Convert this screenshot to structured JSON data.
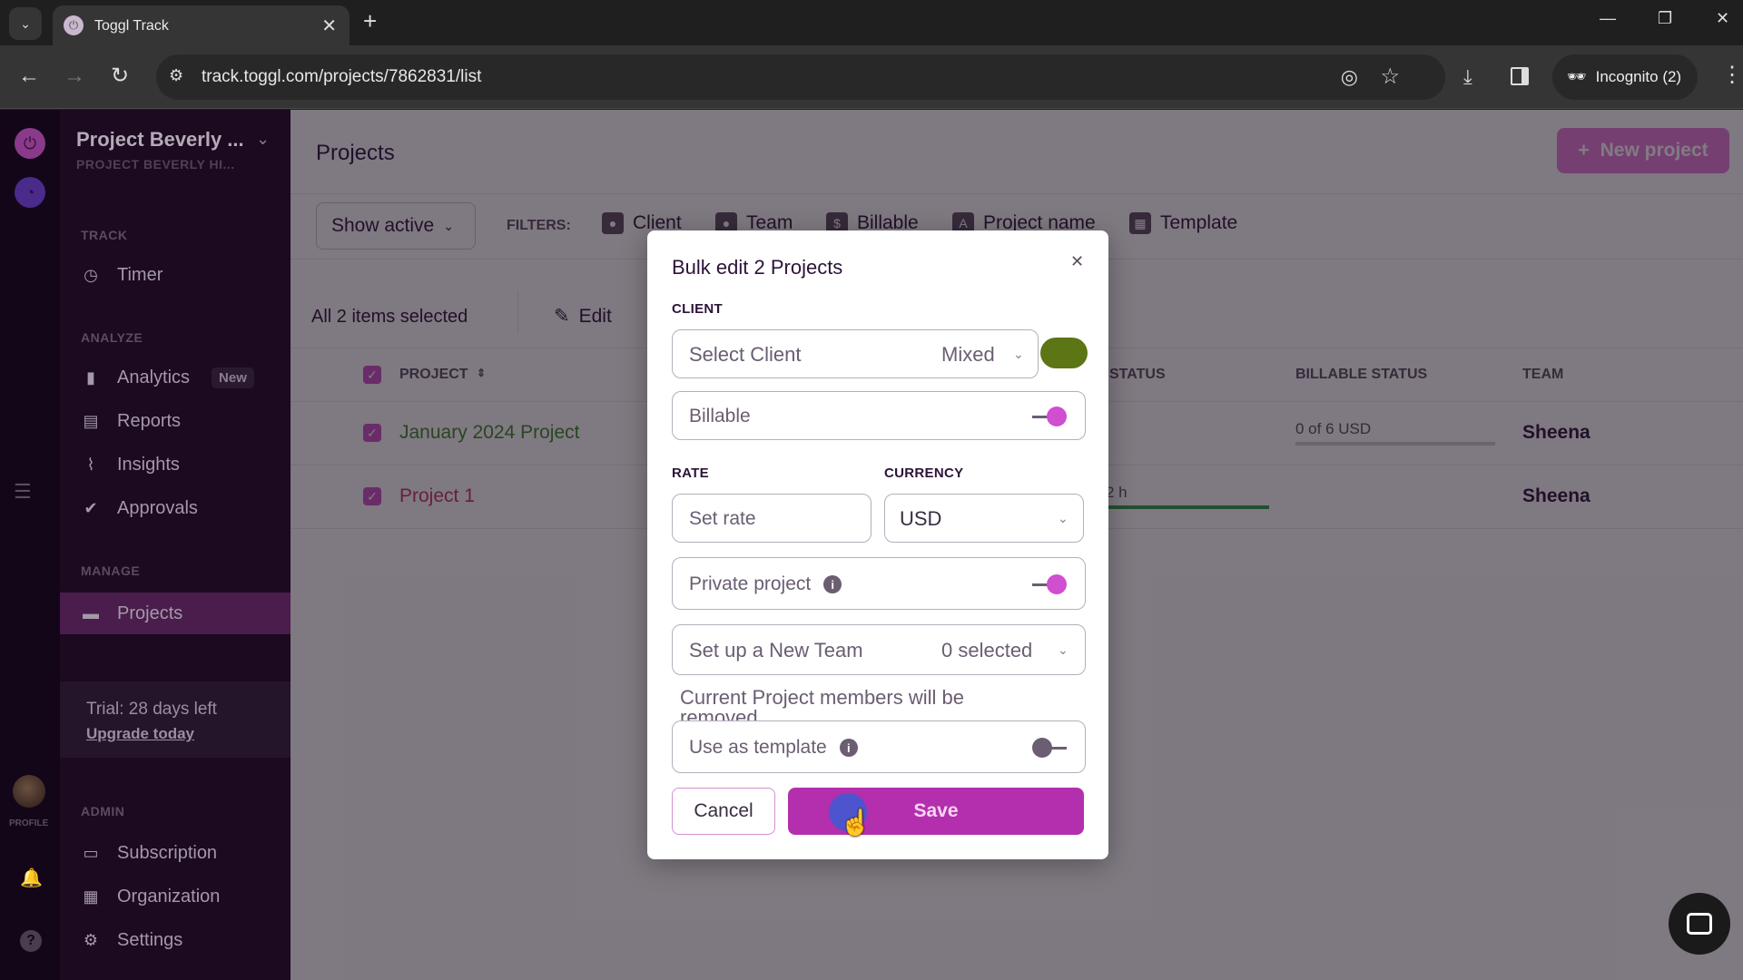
{
  "browser": {
    "tab_title": "Toggl Track",
    "url": "track.toggl.com/projects/7862831/list",
    "incognito_label": "Incognito (2)"
  },
  "sidebar": {
    "workspace_name": "Project Beverly ...",
    "workspace_sub": "PROJECT BEVERLY HI...",
    "sections": {
      "track": "TRACK",
      "analyze": "ANALYZE",
      "manage": "MANAGE",
      "admin": "ADMIN"
    },
    "items": {
      "timer": "Timer",
      "analytics": "Analytics",
      "analytics_badge": "New",
      "reports": "Reports",
      "insights": "Insights",
      "approvals": "Approvals",
      "projects": "Projects",
      "subscription": "Subscription",
      "organization": "Organization",
      "settings": "Settings"
    },
    "trial_text": "Trial: 28 days left",
    "upgrade_label": "Upgrade today",
    "profile_label": "PROFILE"
  },
  "main": {
    "title": "Projects",
    "new_project_label": "New project",
    "show_active_label": "Show active",
    "filters_label": "FILTERS:",
    "filters": [
      "Client",
      "Team",
      "Billable",
      "Project name",
      "Template"
    ],
    "selection_text": "All 2 items selected",
    "edit_label": "Edit",
    "columns": {
      "project": "PROJECT",
      "status": "STATUS",
      "billable_status": "BILLABLE STATUS",
      "team": "TEAM"
    },
    "rows": [
      {
        "name": "January 2024 Project",
        "name_color": "#3d8a2e",
        "billable": "0 of 6 USD",
        "status": "",
        "team": "Sheena"
      },
      {
        "name": "Project 1",
        "name_color": "#c4336b",
        "billable": "",
        "status": "2 h",
        "team": "Sheena"
      }
    ]
  },
  "modal": {
    "title": "Bulk edit 2 Projects",
    "client_label": "CLIENT",
    "client_placeholder": "Select Client",
    "client_value": "Mixed",
    "billable_label": "Billable",
    "billable_on": true,
    "rate_label": "RATE",
    "rate_placeholder": "Set rate",
    "currency_label": "CURRENCY",
    "currency_value": "USD",
    "private_label": "Private project",
    "private_on": true,
    "team_placeholder": "Set up a New Team",
    "team_value": "0 selected",
    "team_note": "Current Project members will be removed",
    "template_label": "Use as template",
    "template_on": false,
    "cancel_label": "Cancel",
    "save_label": "Save"
  },
  "colors": {
    "accent": "#b42fad",
    "sidebar_bg": "#1b0a20",
    "toggle_on": "#d04ed0",
    "green_toggle": "#5c7515"
  }
}
